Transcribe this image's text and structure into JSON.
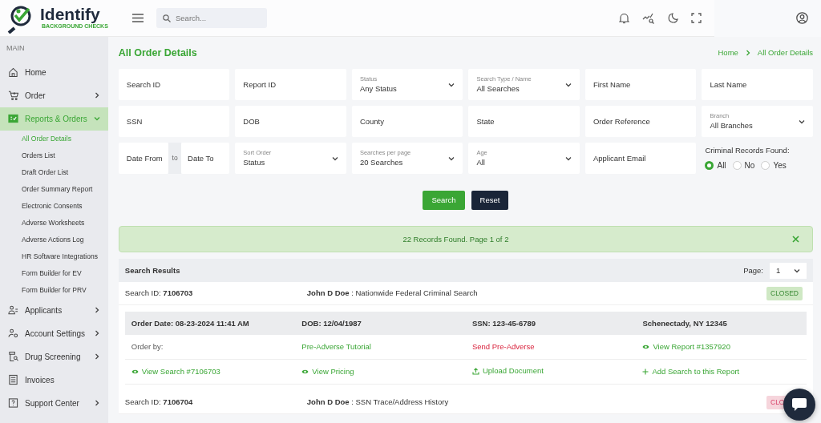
{
  "logo": {
    "title": "Identify",
    "subtitle": "BACKGROUND CHECKS"
  },
  "header": {
    "search": {
      "placeholder": "Search..."
    }
  },
  "sidebar": {
    "section": "MAIN",
    "items": [
      {
        "label": "Home",
        "selected": false
      },
      {
        "label": "Order",
        "selected": false,
        "expanded": false
      },
      {
        "label": "Reports & Orders",
        "selected": true,
        "expanded": true,
        "children": [
          {
            "label": "All Order Details",
            "selected": true
          },
          {
            "label": "Orders List",
            "selected": false
          },
          {
            "label": "Draft Order List",
            "selected": false
          },
          {
            "label": "Order Summary Report",
            "selected": false
          },
          {
            "label": "Electronic Consents",
            "selected": false
          },
          {
            "label": "Adverse Worksheets",
            "selected": false
          },
          {
            "label": "Adverse Actions Log",
            "selected": false
          },
          {
            "label": "HR Software Integrations",
            "selected": false
          },
          {
            "label": "Form Builder for EV",
            "selected": false
          },
          {
            "label": "Form Builder for PRV",
            "selected": false
          }
        ]
      },
      {
        "label": "Applicants",
        "selected": false,
        "expanded": false
      },
      {
        "label": "Account Settings",
        "selected": false,
        "expanded": false
      },
      {
        "label": "Drug Screening",
        "selected": false,
        "expanded": false
      },
      {
        "label": "Invoices",
        "selected": false
      },
      {
        "label": "Support Center",
        "selected": false,
        "expanded": false
      }
    ]
  },
  "page": {
    "title": "All Order Details",
    "breadcrumb": [
      "Home",
      "All Order Details"
    ]
  },
  "filters": [
    {
      "kind": "input",
      "placeholder": "Search ID"
    },
    {
      "kind": "input",
      "placeholder": "Report ID"
    },
    {
      "kind": "select",
      "label": "Status",
      "value": "Any Status"
    },
    {
      "kind": "select",
      "label": "Search Type / Name",
      "value": "All Searches"
    },
    {
      "kind": "input",
      "placeholder": "First Name"
    },
    {
      "kind": "input",
      "placeholder": "Last Name"
    },
    {
      "kind": "input",
      "placeholder": "SSN"
    },
    {
      "kind": "input",
      "placeholder": "DOB"
    },
    {
      "kind": "input",
      "placeholder": "County"
    },
    {
      "kind": "input",
      "placeholder": "State"
    },
    {
      "kind": "input",
      "placeholder": "Order Reference"
    },
    {
      "kind": "select",
      "label": "Branch",
      "value": "All Branches"
    },
    {
      "kind": "daterange",
      "fields": [
        {
          "placeholder": "Date From"
        },
        {
          "placeholder": "Date To"
        }
      ],
      "separator": "to"
    },
    {
      "kind": "select",
      "label": "Sort Order",
      "value": "Status"
    },
    {
      "kind": "select",
      "label": "Searches per page",
      "value": "20 Searches"
    },
    {
      "kind": "select",
      "label": "Age",
      "value": "All"
    },
    {
      "kind": "input",
      "placeholder": "Applicant Email"
    },
    {
      "kind": "radio",
      "label": "Criminal Records Found:",
      "options": [
        {
          "label": "All",
          "selected": true
        },
        {
          "label": "No",
          "selected": false
        },
        {
          "label": "Yes",
          "selected": false
        }
      ]
    }
  ],
  "buttons": [
    {
      "label": "Search",
      "kind": "primary"
    },
    {
      "label": "Reset",
      "kind": "dark"
    }
  ],
  "alert": {
    "text": "22 Records Found. Page 1 of 2"
  },
  "results": {
    "title": "Search Results",
    "page_label": "Page:",
    "page_value": "1",
    "records": [
      {
        "search_id": "Search ID: **7106703**",
        "summary": "**John D Doe** : Nationwide Federal Criminal Search",
        "status": {
          "text": "CLOSED",
          "kind": "success"
        },
        "details": [
          "Order Date: 08-23-2024 11:41 AM",
          "DOB: 12/04/1987",
          "SSN: 123-45-6789",
          "Schenectady, NY 12345"
        ],
        "actions": [
          [
            {
              "text": "Order by:",
              "kind": "plain"
            },
            {
              "text": "Pre-Adverse Tutorial",
              "kind": "link"
            },
            {
              "text": "Send Pre-Adverse",
              "kind": "danger"
            },
            {
              "text": "View Report #1357920",
              "kind": "view"
            }
          ],
          [
            {
              "text": "View Search #7106703",
              "kind": "view"
            },
            {
              "text": "View Pricing",
              "kind": "view"
            },
            {
              "text": "Upload Document",
              "kind": "upload"
            },
            {
              "text": "Add Search to this Report",
              "kind": "add"
            }
          ]
        ]
      },
      {
        "search_id": "Search ID: **7106704**",
        "summary": "**John D Doe** : SSN Trace/Address History",
        "status": {
          "text": "CLO",
          "kind": "danger"
        }
      }
    ]
  }
}
